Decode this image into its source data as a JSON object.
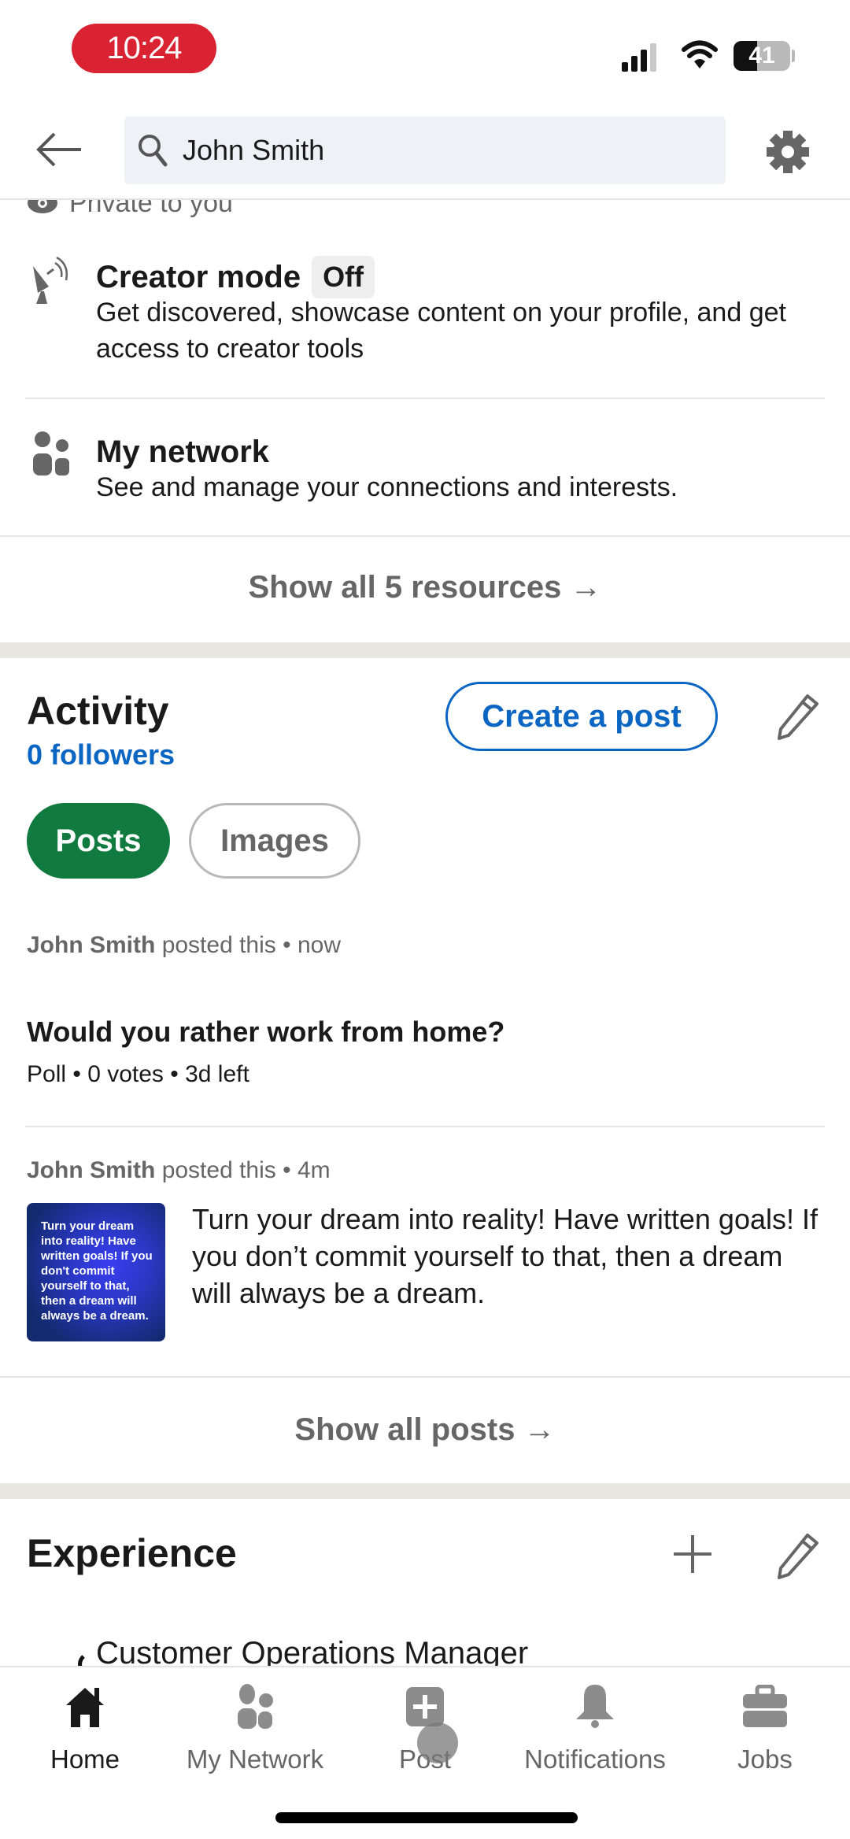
{
  "status_bar": {
    "time": "10:24",
    "battery": "41",
    "battery_level_percent": 41
  },
  "top_nav": {
    "search_value": "John Smith"
  },
  "resources": {
    "private_label": "Private to you",
    "items": [
      {
        "title": "Creator mode",
        "badge": "Off",
        "description": "Get discovered, showcase content on your profile, and get access to creator tools"
      },
      {
        "title": "My network",
        "description": "See and manage your connections and interests."
      }
    ],
    "show_all": "Show all 5 resources →"
  },
  "activity": {
    "title": "Activity",
    "followers": "0 followers",
    "create_post": "Create a post",
    "filters": [
      {
        "label": "Posts",
        "active": true
      },
      {
        "label": "Images",
        "active": false
      }
    ],
    "posts": [
      {
        "author": "John Smith",
        "action": "posted this",
        "time": "now",
        "title": "Would you rather work from home?",
        "info": "Poll • 0 votes • 3d left"
      },
      {
        "author": "John Smith",
        "action": "posted this",
        "time": "4m",
        "thumbnail_text": "Turn your dream into reality! Have written goals! If you don't commit yourself to that, then a dream will always be a dream.",
        "text": "Turn your dream into reality! Have written goals! If you don’t commit yourself to that, then a dream will always be a dream."
      }
    ],
    "show_all": "Show all posts →"
  },
  "experience": {
    "title": "Experience",
    "items": [
      {
        "title": "Customer Operations Manager"
      }
    ]
  },
  "bottom_nav": {
    "items": [
      {
        "label": "Home",
        "icon": "home-icon",
        "active": true
      },
      {
        "label": "My Network",
        "icon": "people-icon",
        "active": false
      },
      {
        "label": "Post",
        "icon": "plus-square-icon",
        "active": false
      },
      {
        "label": "Notifications",
        "icon": "bell-icon",
        "active": false
      },
      {
        "label": "Jobs",
        "icon": "briefcase-icon",
        "active": false
      }
    ]
  },
  "colors": {
    "accent_blue": "#0a66c2",
    "active_green": "#117a3f",
    "time_pill_red": "#d92332",
    "section_gap": "#eae6e1"
  }
}
